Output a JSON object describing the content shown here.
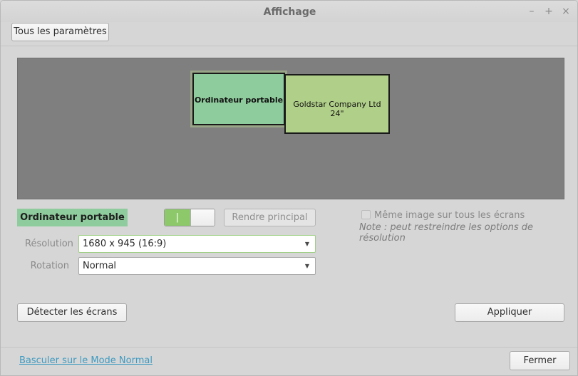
{
  "window": {
    "title": "Affichage"
  },
  "toolbar": {
    "all_settings_label": "Tous les paramètres"
  },
  "arrangement": {
    "monitors": [
      {
        "label": "Ordinateur portable"
      },
      {
        "label": "Goldstar Company Ltd 24\""
      }
    ]
  },
  "selected_monitor": {
    "name": "Ordinateur portable",
    "toggle_state_label": "|",
    "make_primary_label": "Rendre principal"
  },
  "mirror": {
    "label": "Même image sur tous les écrans",
    "note": "Note : peut restreindre les options de résolution"
  },
  "settings": {
    "resolution_label": "Résolution",
    "resolution_value": "1680 x 945 (16:9)",
    "rotation_label": "Rotation",
    "rotation_value": "Normal"
  },
  "actions": {
    "detect_label": "Détecter les écrans",
    "apply_label": "Appliquer",
    "mode_link": "Basculer sur le Mode Normal",
    "close_label": "Fermer"
  },
  "colors": {
    "laptop_monitor": "#8fcc9d",
    "goldstar_monitor": "#b0cf88",
    "toggle_on": "#8dc96a",
    "link": "#3f9ac0"
  }
}
